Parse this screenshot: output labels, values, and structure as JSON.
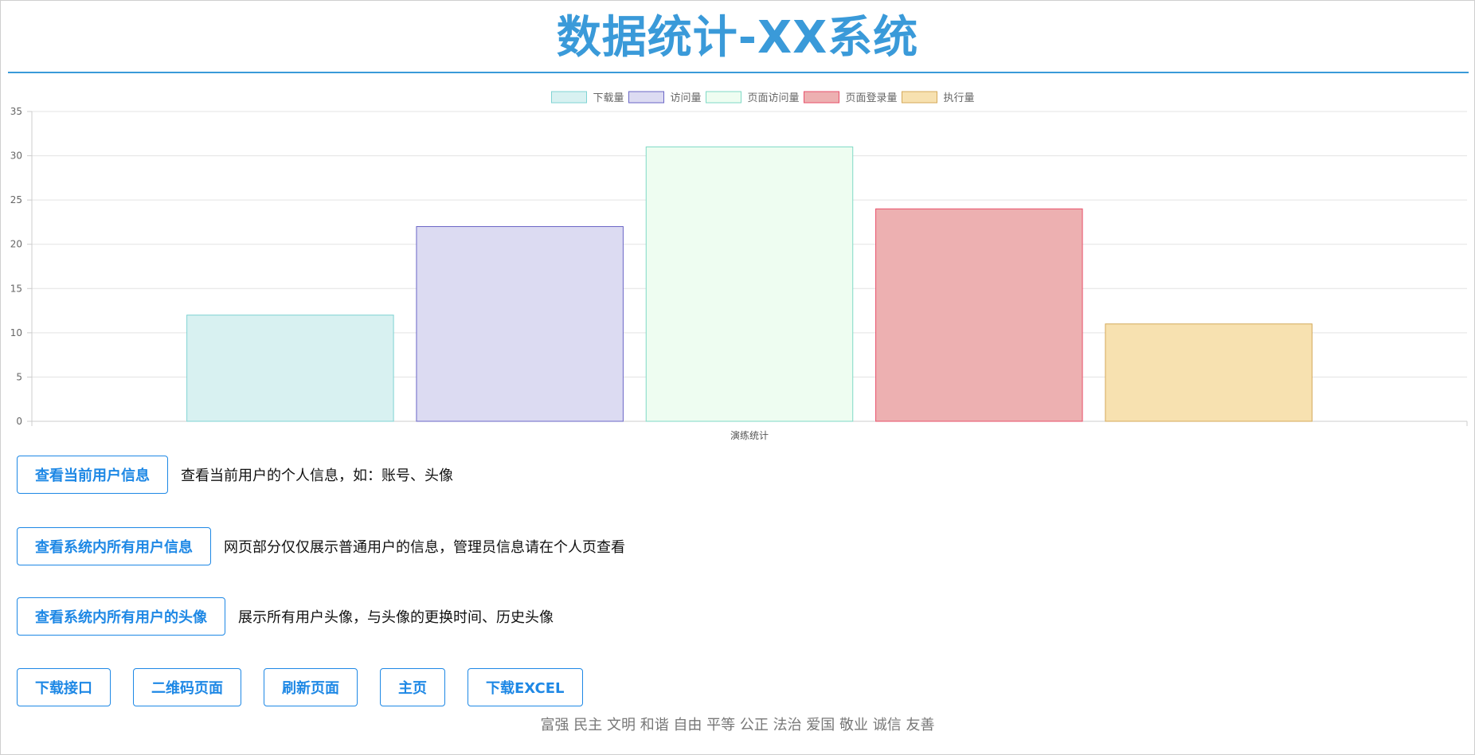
{
  "page": {
    "title": "数据统计-XX系统"
  },
  "chart_data": {
    "type": "bar",
    "categories": [
      "演练统计"
    ],
    "series": [
      {
        "name": "下载量",
        "values": [
          12
        ],
        "fill": "#d8f1f1",
        "stroke": "#7fd3d3"
      },
      {
        "name": "访问量",
        "values": [
          22
        ],
        "fill": "#dcdbf2",
        "stroke": "#6a66c6"
      },
      {
        "name": "页面访问量",
        "values": [
          31
        ],
        "fill": "#eefdf1",
        "stroke": "#7fd9c6"
      },
      {
        "name": "页面登录量",
        "values": [
          24
        ],
        "fill": "#edb0b1",
        "stroke": "#e8506a"
      },
      {
        "name": "执行量",
        "values": [
          11
        ],
        "fill": "#f7e1b0",
        "stroke": "#d4a95a"
      }
    ],
    "ylim": [
      0,
      35
    ],
    "yticks": [
      0,
      5,
      10,
      15,
      20,
      25,
      30,
      35
    ],
    "grid": true,
    "legend": "top-center",
    "xlabel": "",
    "ylabel": ""
  },
  "actions": [
    {
      "label": "查看当前用户信息",
      "desc": "查看当前用户的个人信息，如：账号、头像"
    },
    {
      "label": "查看系统内所有用户信息",
      "desc": "网页部分仅仅展示普通用户的信息，管理员信息请在个人页查看"
    },
    {
      "label": "查看系统内所有用户的头像",
      "desc": "展示所有用户头像，与头像的更换时间、历史头像"
    }
  ],
  "buttons": [
    "下载接口",
    "二维码页面",
    "刷新页面",
    "主页",
    "下载EXCEL"
  ],
  "footer": "富强 民主 文明 和谐 自由 平等 公正 法治 爱国 敬业 诚信 友善"
}
